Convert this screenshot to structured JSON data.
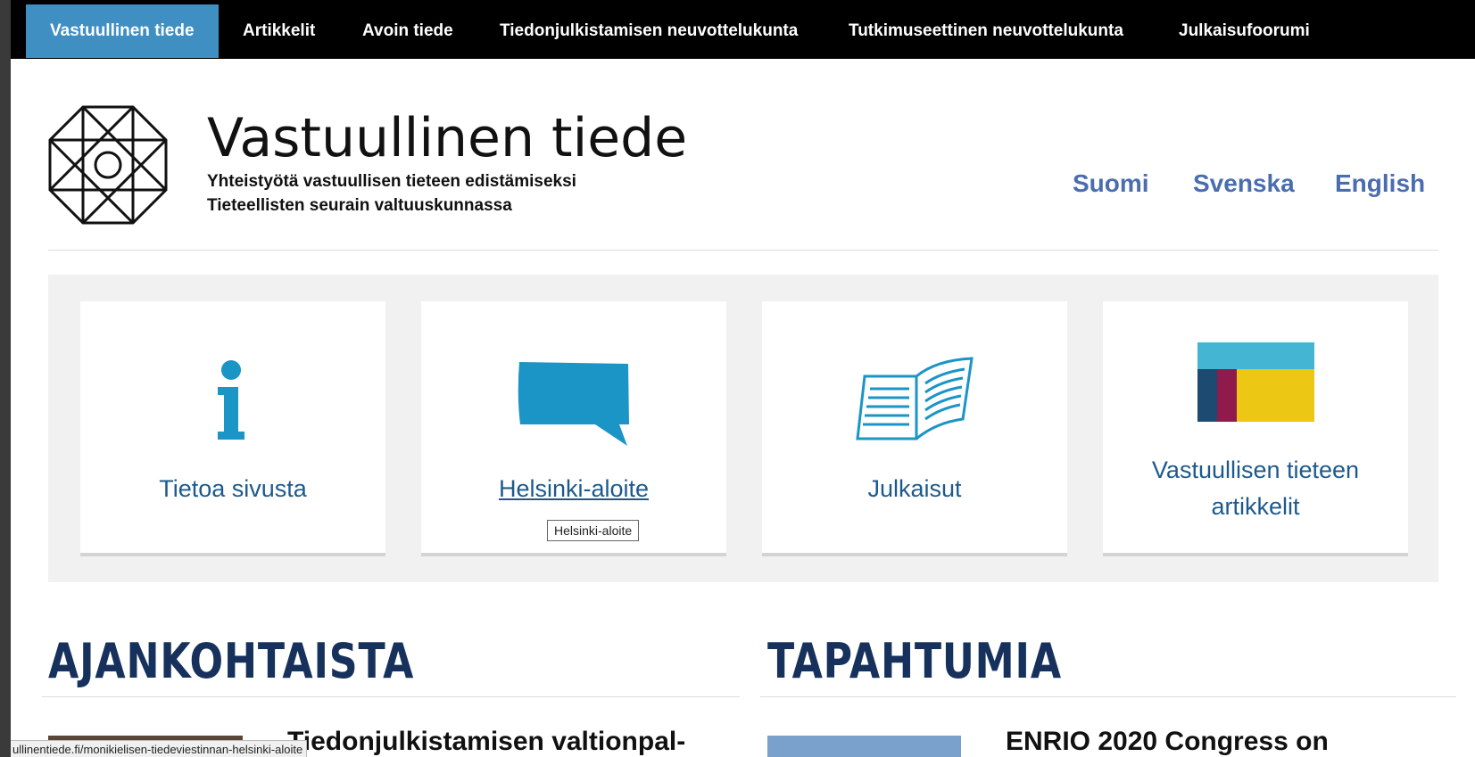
{
  "topnav": {
    "items": [
      {
        "label": "Vastuullinen tiede",
        "active": true
      },
      {
        "label": "Artikkelit"
      },
      {
        "label": "Avoin tiede"
      },
      {
        "label": "Tiedonjulkistamisen neuvottelukunta"
      },
      {
        "label": "Tutkimuseettinen neuvottelukunta"
      },
      {
        "label": "Julkaisufoorumi"
      }
    ]
  },
  "header": {
    "title": "Vastuullinen tiede",
    "tagline_line1": "Yhteistyötä vastuullisen tieteen edistämiseksi",
    "tagline_line2": "Tieteellisten seurain valtuuskunnassa",
    "languages": [
      "Suomi",
      "Svenska",
      "English"
    ]
  },
  "cards": [
    {
      "label": "Tietoa sivusta",
      "icon": "info-icon"
    },
    {
      "label": "Helsinki-aloite",
      "icon": "speech-bubble-icon",
      "tooltip": "Helsinki-aloite"
    },
    {
      "label": "Julkaisut",
      "icon": "open-book-icon"
    },
    {
      "label_line1": "Vastuullisen tieteen",
      "label_line2": "artikkelit",
      "icon": "color-blocks-icon"
    }
  ],
  "sections": {
    "news_heading": "AJANKOHTAISTA",
    "events_heading": "TAPAHTUMIA",
    "news_first_title": "Tiedonjulkistamisen valtionpal-",
    "event_first_title": "ENRIO 2020 Congress on"
  },
  "statusbar": {
    "url": "ullinentiede.fi/monikielisen-tiedeviestinnan-helsinki-aloite"
  },
  "colors": {
    "nav_active": "#3f8fc3",
    "link_blue": "#4a6db0",
    "card_label": "#1d5a8c",
    "heading": "#16315c",
    "icon_blue": "#1b94c6"
  }
}
